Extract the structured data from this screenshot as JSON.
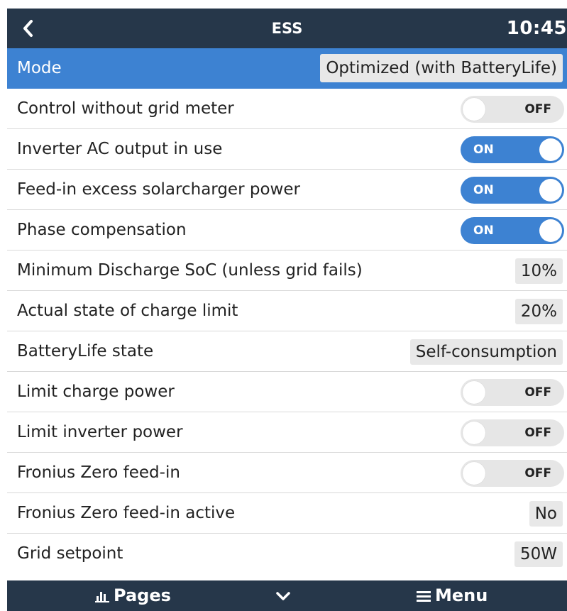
{
  "header": {
    "title": "ESS",
    "time": "10:45"
  },
  "rows": [
    {
      "label": "Mode",
      "value": "Optimized (with BatteryLife)"
    },
    {
      "label": "Control without grid meter",
      "toggle": "OFF"
    },
    {
      "label": "Inverter AC output in use",
      "toggle": "ON"
    },
    {
      "label": "Feed-in excess solarcharger power",
      "toggle": "ON"
    },
    {
      "label": "Phase compensation",
      "toggle": "ON"
    },
    {
      "label": "Minimum Discharge SoC (unless grid fails)",
      "value": "10%"
    },
    {
      "label": "Actual state of charge limit",
      "value": "20%"
    },
    {
      "label": "BatteryLife state",
      "value": "Self-consumption"
    },
    {
      "label": "Limit charge power",
      "toggle": "OFF"
    },
    {
      "label": "Limit inverter power",
      "toggle": "OFF"
    },
    {
      "label": "Fronius Zero feed-in",
      "toggle": "OFF"
    },
    {
      "label": "Fronius Zero feed-in active",
      "value": "No"
    },
    {
      "label": "Grid setpoint",
      "value": "50W"
    }
  ],
  "footer": {
    "pages_label": "Pages",
    "menu_label": "Menu"
  },
  "colors": {
    "header_bg": "#26374a",
    "accent": "#3d82d2",
    "value_bg": "#e8e8e8"
  },
  "icons": {
    "back": "chevron-left-icon",
    "pages": "bar-chart-icon",
    "down": "chevron-down-icon",
    "menu": "hamburger-icon"
  }
}
